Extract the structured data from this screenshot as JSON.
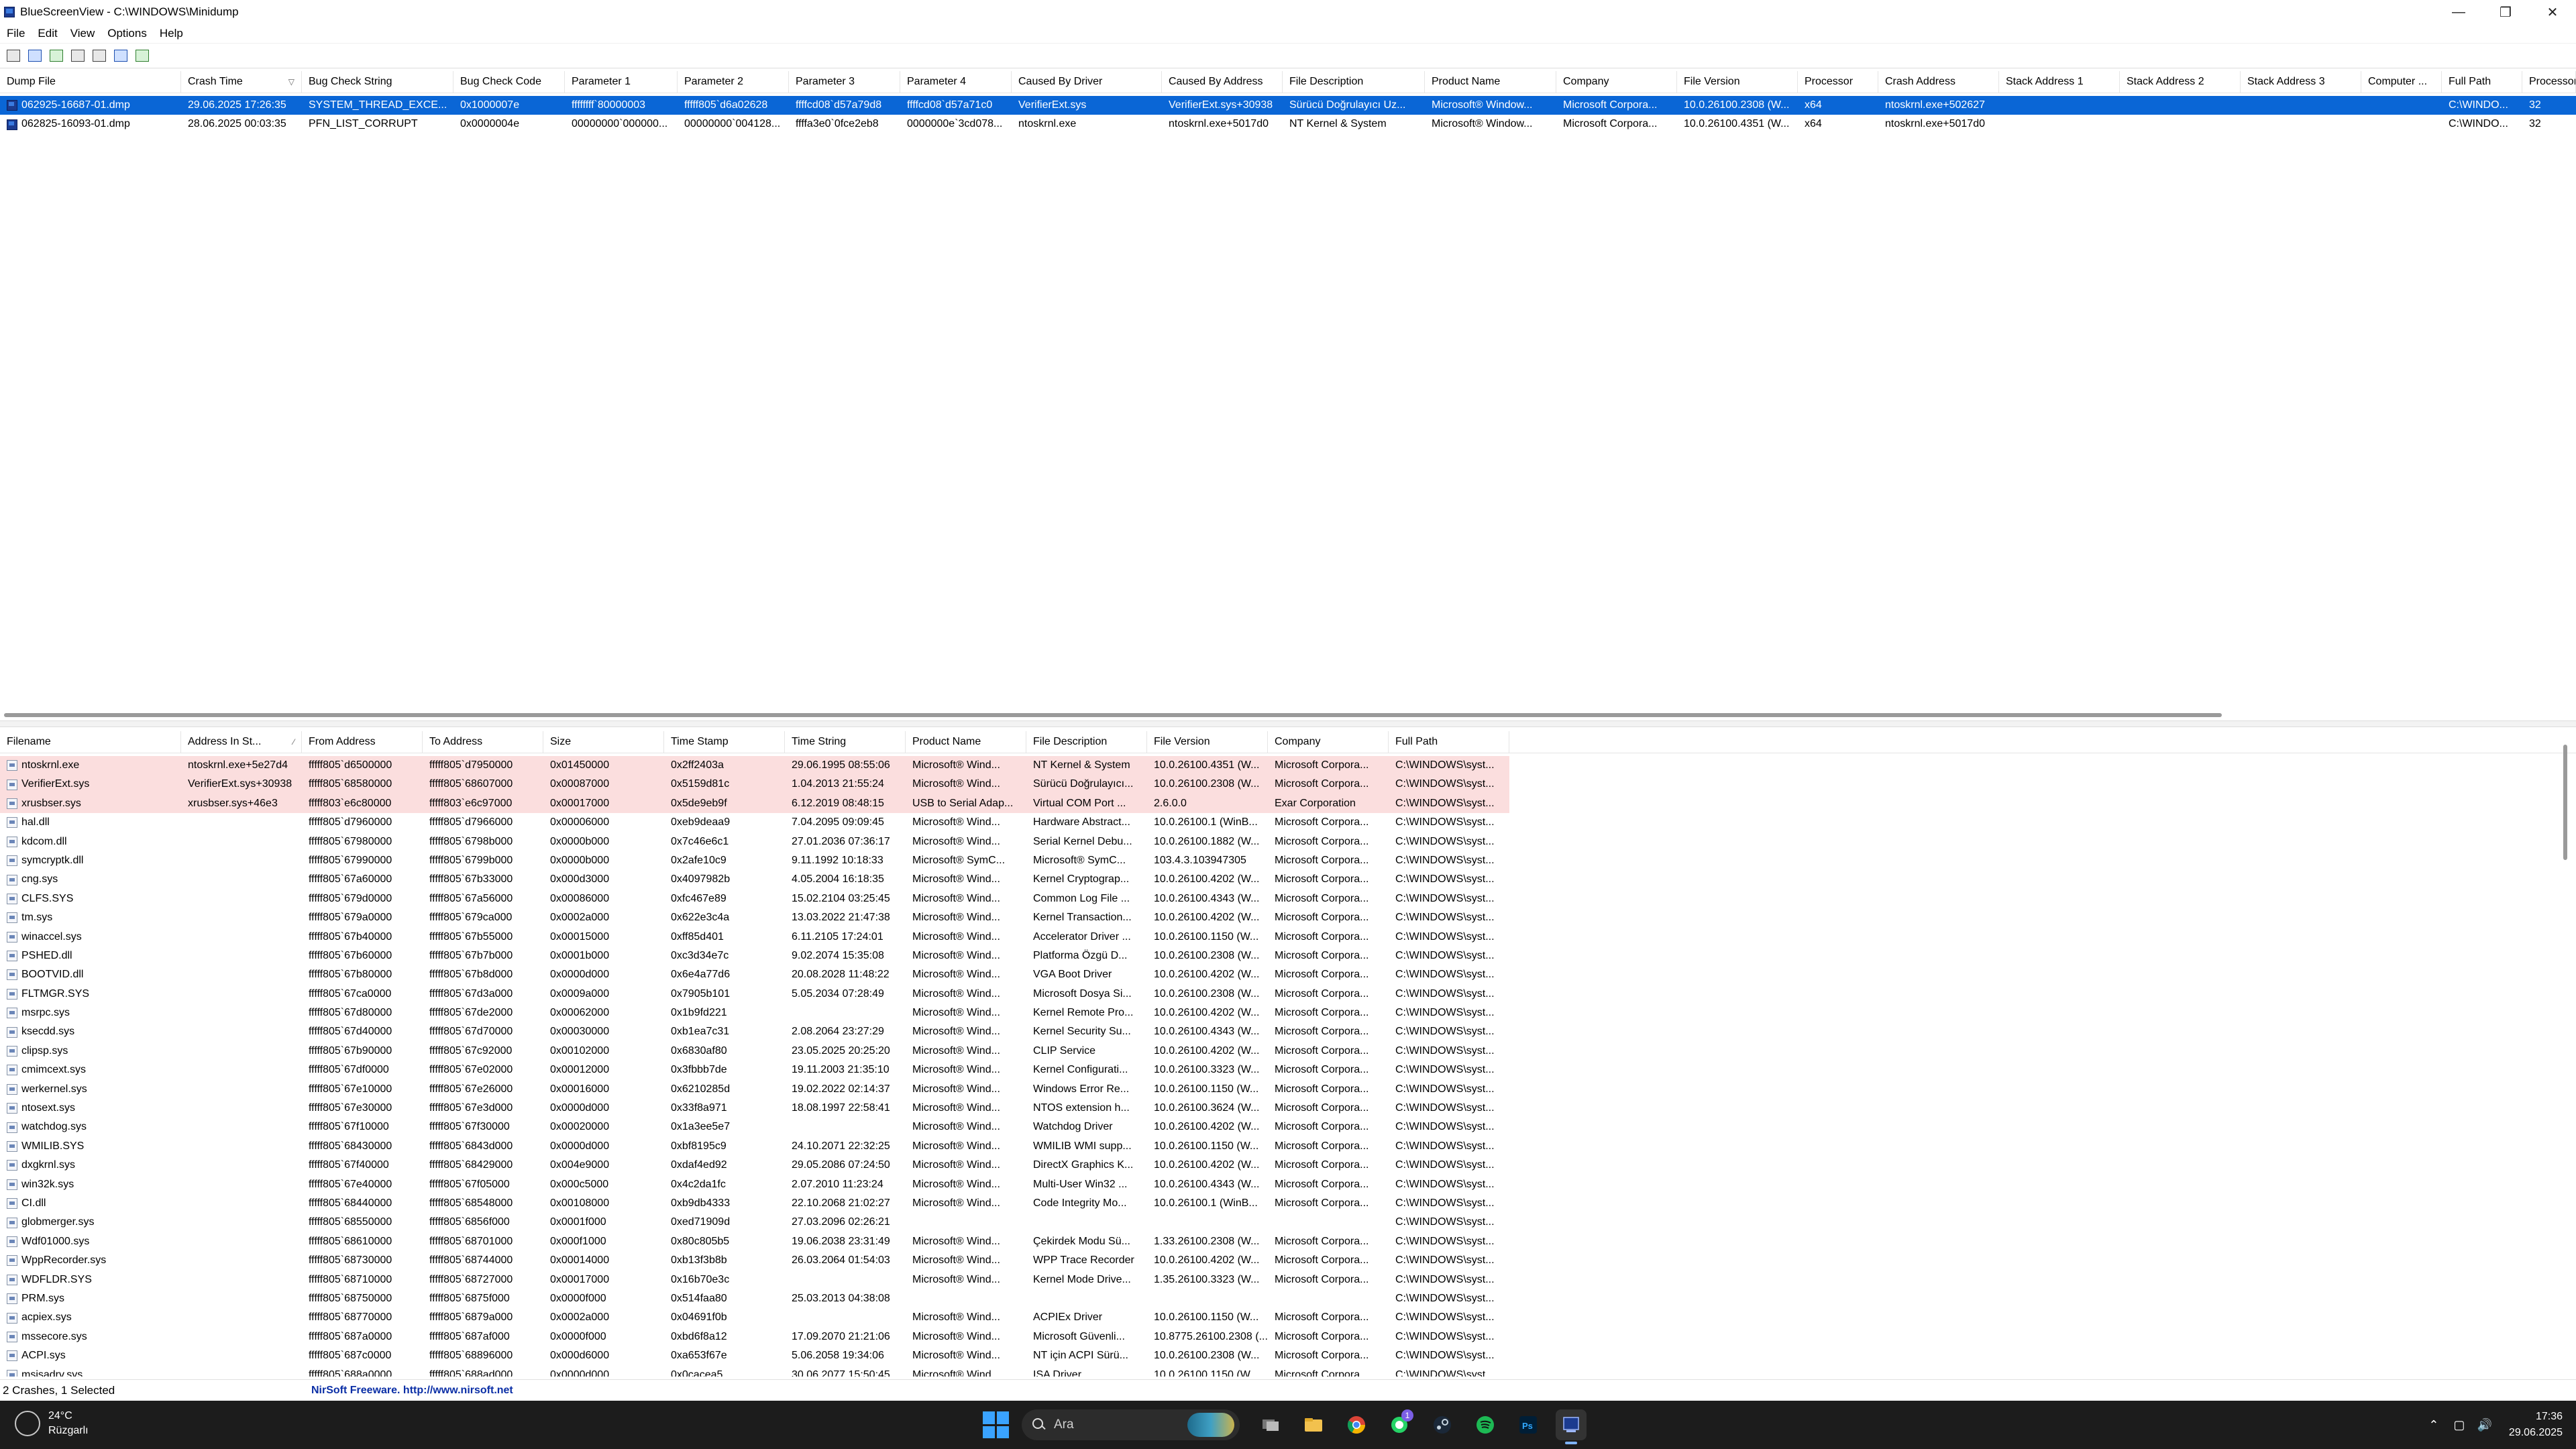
{
  "window": {
    "title": "BlueScreenView - C:\\WINDOWS\\Minidump"
  },
  "menu": [
    "File",
    "Edit",
    "View",
    "Options",
    "Help"
  ],
  "toolbar_icons": [
    "properties-icon",
    "save-icon",
    "html-report-icon",
    "copy-icon",
    "open-folder-icon",
    "find-icon",
    "exit-icon"
  ],
  "crashes": {
    "columns": [
      "Dump File",
      "Crash Time",
      "Bug Check String",
      "Bug Check Code",
      "Parameter 1",
      "Parameter 2",
      "Parameter 3",
      "Parameter 4",
      "Caused By Driver",
      "Caused By Address",
      "File Description",
      "Product Name",
      "Company",
      "File Version",
      "Processor",
      "Crash Address",
      "Stack Address 1",
      "Stack Address 2",
      "Stack Address 3",
      "Computer ...",
      "Full Path",
      "Processors"
    ],
    "sorted_column_marker": "▽",
    "rows": [
      [
        "062925-16687-01.dmp",
        "29.06.2025 17:26:35",
        "SYSTEM_THREAD_EXCE...",
        "0x1000007e",
        "ffffffff`80000003",
        "fffff805`d6a02628",
        "ffffcd08`d57a79d8",
        "ffffcd08`d57a71c0",
        "VerifierExt.sys",
        "VerifierExt.sys+30938",
        "Sürücü Doğrulayıcı Uz...",
        "Microsoft® Window...",
        "Microsoft Corpora...",
        "10.0.26100.2308 (W...",
        "x64",
        "ntoskrnl.exe+502627",
        "",
        "",
        "",
        "",
        "C:\\WINDO...",
        "32"
      ],
      [
        "062825-16093-01.dmp",
        "28.06.2025 00:03:35",
        "PFN_LIST_CORRUPT",
        "0x0000004e",
        "00000000`000000...",
        "00000000`004128...",
        "ffffa3e0`0fce2eb8",
        "0000000e`3cd078...",
        "ntoskrnl.exe",
        "ntoskrnl.exe+5017d0",
        "NT Kernel & System",
        "Microsoft® Window...",
        "Microsoft Corpora...",
        "10.0.26100.4351 (W...",
        "x64",
        "ntoskrnl.exe+5017d0",
        "",
        "",
        "",
        "",
        "C:\\WINDO...",
        "32"
      ]
    ]
  },
  "drivers": {
    "columns": [
      "Filename",
      "Address In St...",
      "From Address",
      "To Address",
      "Size",
      "Time Stamp",
      "Time String",
      "Product Name",
      "File Description",
      "File Version",
      "Company",
      "Full Path"
    ],
    "sorted_column_marker": "⁄",
    "rows": [
      [
        "ntoskrnl.exe",
        "ntoskrnl.exe+5e27d4",
        "fffff805`d6500000",
        "fffff805`d7950000",
        "0x01450000",
        "0x2ff2403a",
        "29.06.1995 08:55:06",
        "Microsoft® Wind...",
        "NT Kernel & System",
        "10.0.26100.4351 (W...",
        "Microsoft Corpora...",
        "C:\\WINDOWS\\syst..."
      ],
      [
        "VerifierExt.sys",
        "VerifierExt.sys+30938",
        "fffff805`68580000",
        "fffff805`68607000",
        "0x00087000",
        "0x5159d81c",
        "1.04.2013 21:55:24",
        "Microsoft® Wind...",
        "Sürücü Doğrulayıcı...",
        "10.0.26100.2308 (W...",
        "Microsoft Corpora...",
        "C:\\WINDOWS\\syst..."
      ],
      [
        "xrusbser.sys",
        "xrusbser.sys+46e3",
        "fffff803`e6c80000",
        "fffff803`e6c97000",
        "0x00017000",
        "0x5de9eb9f",
        "6.12.2019 08:48:15",
        "USB to Serial Adap...",
        "Virtual COM Port ...",
        "2.6.0.0",
        "Exar Corporation",
        "C:\\WINDOWS\\syst..."
      ],
      [
        "hal.dll",
        "",
        "fffff805`d7960000",
        "fffff805`d7966000",
        "0x00006000",
        "0xeb9deaa9",
        "7.04.2095 09:09:45",
        "Microsoft® Wind...",
        "Hardware Abstract...",
        "10.0.26100.1 (WinB...",
        "Microsoft Corpora...",
        "C:\\WINDOWS\\syst..."
      ],
      [
        "kdcom.dll",
        "",
        "fffff805`67980000",
        "fffff805`6798b000",
        "0x0000b000",
        "0x7c46e6c1",
        "27.01.2036 07:36:17",
        "Microsoft® Wind...",
        "Serial Kernel Debu...",
        "10.0.26100.1882 (W...",
        "Microsoft Corpora...",
        "C:\\WINDOWS\\syst..."
      ],
      [
        "symcryptk.dll",
        "",
        "fffff805`67990000",
        "fffff805`6799b000",
        "0x0000b000",
        "0x2afe10c9",
        "9.11.1992 10:18:33",
        "Microsoft® SymC...",
        "Microsoft® SymC...",
        "103.4.3.103947305",
        "Microsoft Corpora...",
        "C:\\WINDOWS\\syst..."
      ],
      [
        "cng.sys",
        "",
        "fffff805`67a60000",
        "fffff805`67b33000",
        "0x000d3000",
        "0x4097982b",
        "4.05.2004 16:18:35",
        "Microsoft® Wind...",
        "Kernel Cryptograp...",
        "10.0.26100.4202 (W...",
        "Microsoft Corpora...",
        "C:\\WINDOWS\\syst..."
      ],
      [
        "CLFS.SYS",
        "",
        "fffff805`679d0000",
        "fffff805`67a56000",
        "0x00086000",
        "0xfc467e89",
        "15.02.2104 03:25:45",
        "Microsoft® Wind...",
        "Common Log File ...",
        "10.0.26100.4343 (W...",
        "Microsoft Corpora...",
        "C:\\WINDOWS\\syst..."
      ],
      [
        "tm.sys",
        "",
        "fffff805`679a0000",
        "fffff805`679ca000",
        "0x0002a000",
        "0x622e3c4a",
        "13.03.2022 21:47:38",
        "Microsoft® Wind...",
        "Kernel Transaction...",
        "10.0.26100.4202 (W...",
        "Microsoft Corpora...",
        "C:\\WINDOWS\\syst..."
      ],
      [
        "winaccel.sys",
        "",
        "fffff805`67b40000",
        "fffff805`67b55000",
        "0x00015000",
        "0xff85d401",
        "6.11.2105 17:24:01",
        "Microsoft® Wind...",
        "Accelerator Driver ...",
        "10.0.26100.1150 (W...",
        "Microsoft Corpora...",
        "C:\\WINDOWS\\syst..."
      ],
      [
        "PSHED.dll",
        "",
        "fffff805`67b60000",
        "fffff805`67b7b000",
        "0x0001b000",
        "0xc3d34e7c",
        "9.02.2074 15:35:08",
        "Microsoft® Wind...",
        "Platforma Özgü D...",
        "10.0.26100.2308 (W...",
        "Microsoft Corpora...",
        "C:\\WINDOWS\\syst..."
      ],
      [
        "BOOTVID.dll",
        "",
        "fffff805`67b80000",
        "fffff805`67b8d000",
        "0x0000d000",
        "0x6e4a77d6",
        "20.08.2028 11:48:22",
        "Microsoft® Wind...",
        "VGA Boot Driver",
        "10.0.26100.4202 (W...",
        "Microsoft Corpora...",
        "C:\\WINDOWS\\syst..."
      ],
      [
        "FLTMGR.SYS",
        "",
        "fffff805`67ca0000",
        "fffff805`67d3a000",
        "0x0009a000",
        "0x7905b101",
        "5.05.2034 07:28:49",
        "Microsoft® Wind...",
        "Microsoft Dosya Si...",
        "10.0.26100.2308 (W...",
        "Microsoft Corpora...",
        "C:\\WINDOWS\\syst..."
      ],
      [
        "msrpc.sys",
        "",
        "fffff805`67d80000",
        "fffff805`67de2000",
        "0x00062000",
        "0x1b9fd221",
        "",
        "Microsoft® Wind...",
        "Kernel Remote Pro...",
        "10.0.26100.4202 (W...",
        "Microsoft Corpora...",
        "C:\\WINDOWS\\syst..."
      ],
      [
        "ksecdd.sys",
        "",
        "fffff805`67d40000",
        "fffff805`67d70000",
        "0x00030000",
        "0xb1ea7c31",
        "2.08.2064 23:27:29",
        "Microsoft® Wind...",
        "Kernel Security Su...",
        "10.0.26100.4343 (W...",
        "Microsoft Corpora...",
        "C:\\WINDOWS\\syst..."
      ],
      [
        "clipsp.sys",
        "",
        "fffff805`67b90000",
        "fffff805`67c92000",
        "0x00102000",
        "0x6830af80",
        "23.05.2025 20:25:20",
        "Microsoft® Wind...",
        "CLIP Service",
        "10.0.26100.4202 (W...",
        "Microsoft Corpora...",
        "C:\\WINDOWS\\syst..."
      ],
      [
        "cmimcext.sys",
        "",
        "fffff805`67df0000",
        "fffff805`67e02000",
        "0x00012000",
        "0x3fbbb7de",
        "19.11.2003 21:35:10",
        "Microsoft® Wind...",
        "Kernel Configurati...",
        "10.0.26100.3323 (W...",
        "Microsoft Corpora...",
        "C:\\WINDOWS\\syst..."
      ],
      [
        "werkernel.sys",
        "",
        "fffff805`67e10000",
        "fffff805`67e26000",
        "0x00016000",
        "0x6210285d",
        "19.02.2022 02:14:37",
        "Microsoft® Wind...",
        "Windows Error Re...",
        "10.0.26100.1150 (W...",
        "Microsoft Corpora...",
        "C:\\WINDOWS\\syst..."
      ],
      [
        "ntosext.sys",
        "",
        "fffff805`67e30000",
        "fffff805`67e3d000",
        "0x0000d000",
        "0x33f8a971",
        "18.08.1997 22:58:41",
        "Microsoft® Wind...",
        "NTOS extension h...",
        "10.0.26100.3624 (W...",
        "Microsoft Corpora...",
        "C:\\WINDOWS\\syst..."
      ],
      [
        "watchdog.sys",
        "",
        "fffff805`67f10000",
        "fffff805`67f30000",
        "0x00020000",
        "0x1a3ee5e7",
        "",
        "Microsoft® Wind...",
        "Watchdog Driver",
        "10.0.26100.4202 (W...",
        "Microsoft Corpora...",
        "C:\\WINDOWS\\syst..."
      ],
      [
        "WMILIB.SYS",
        "",
        "fffff805`68430000",
        "fffff805`6843d000",
        "0x0000d000",
        "0xbf8195c9",
        "24.10.2071 22:32:25",
        "Microsoft® Wind...",
        "WMILIB WMI supp...",
        "10.0.26100.1150 (W...",
        "Microsoft Corpora...",
        "C:\\WINDOWS\\syst..."
      ],
      [
        "dxgkrnl.sys",
        "",
        "fffff805`67f40000",
        "fffff805`68429000",
        "0x004e9000",
        "0xdaf4ed92",
        "29.05.2086 07:24:50",
        "Microsoft® Wind...",
        "DirectX Graphics K...",
        "10.0.26100.4202 (W...",
        "Microsoft Corpora...",
        "C:\\WINDOWS\\syst..."
      ],
      [
        "win32k.sys",
        "",
        "fffff805`67e40000",
        "fffff805`67f05000",
        "0x000c5000",
        "0x4c2da1fc",
        "2.07.2010 11:23:24",
        "Microsoft® Wind...",
        "Multi-User Win32 ...",
        "10.0.26100.4343 (W...",
        "Microsoft Corpora...",
        "C:\\WINDOWS\\syst..."
      ],
      [
        "CI.dll",
        "",
        "fffff805`68440000",
        "fffff805`68548000",
        "0x00108000",
        "0xb9db4333",
        "22.10.2068 21:02:27",
        "Microsoft® Wind...",
        "Code Integrity Mo...",
        "10.0.26100.1 (WinB...",
        "Microsoft Corpora...",
        "C:\\WINDOWS\\syst..."
      ],
      [
        "globmerger.sys",
        "",
        "fffff805`68550000",
        "fffff805`6856f000",
        "0x0001f000",
        "0xed71909d",
        "27.03.2096 02:26:21",
        "",
        "",
        "",
        "",
        "C:\\WINDOWS\\syst..."
      ],
      [
        "Wdf01000.sys",
        "",
        "fffff805`68610000",
        "fffff805`68701000",
        "0x000f1000",
        "0x80c805b5",
        "19.06.2038 23:31:49",
        "Microsoft® Wind...",
        "Çekirdek Modu Sü...",
        "1.33.26100.2308 (W...",
        "Microsoft Corpora...",
        "C:\\WINDOWS\\syst..."
      ],
      [
        "WppRecorder.sys",
        "",
        "fffff805`68730000",
        "fffff805`68744000",
        "0x00014000",
        "0xb13f3b8b",
        "26.03.2064 01:54:03",
        "Microsoft® Wind...",
        "WPP Trace Recorder",
        "10.0.26100.4202 (W...",
        "Microsoft Corpora...",
        "C:\\WINDOWS\\syst..."
      ],
      [
        "WDFLDR.SYS",
        "",
        "fffff805`68710000",
        "fffff805`68727000",
        "0x00017000",
        "0x16b70e3c",
        "",
        "Microsoft® Wind...",
        "Kernel Mode Drive...",
        "1.35.26100.3323 (W...",
        "Microsoft Corpora...",
        "C:\\WINDOWS\\syst..."
      ],
      [
        "PRM.sys",
        "",
        "fffff805`68750000",
        "fffff805`6875f000",
        "0x0000f000",
        "0x514faa80",
        "25.03.2013 04:38:08",
        "",
        "",
        "",
        "",
        "C:\\WINDOWS\\syst..."
      ],
      [
        "acpiex.sys",
        "",
        "fffff805`68770000",
        "fffff805`6879a000",
        "0x0002a000",
        "0x04691f0b",
        "",
        "Microsoft® Wind...",
        "ACPIEx Driver",
        "10.0.26100.1150 (W...",
        "Microsoft Corpora...",
        "C:\\WINDOWS\\syst..."
      ],
      [
        "mssecore.sys",
        "",
        "fffff805`687a0000",
        "fffff805`687af000",
        "0x0000f000",
        "0xbd6f8a12",
        "17.09.2070 21:21:06",
        "Microsoft® Wind...",
        "Microsoft Güvenli...",
        "10.8775.26100.2308 (...",
        "Microsoft Corpora...",
        "C:\\WINDOWS\\syst..."
      ],
      [
        "ACPI.sys",
        "",
        "fffff805`687c0000",
        "fffff805`68896000",
        "0x000d6000",
        "0xa653f67e",
        "5.06.2058 19:34:06",
        "Microsoft® Wind...",
        "NT için ACPI Sürü...",
        "10.0.26100.2308 (W...",
        "Microsoft Corpora...",
        "C:\\WINDOWS\\syst..."
      ],
      [
        "msisadrv.sys",
        "",
        "fffff805`688a0000",
        "fffff805`688ad000",
        "0x0000d000",
        "0x0cacea5",
        "30.06.2077 15:50:45",
        "Microsoft® Wind...",
        "ISA Driver",
        "10.0.26100.1150 (W...",
        "Microsoft Corpora...",
        "C:\\WINDOWS\\syst..."
      ]
    ]
  },
  "status": {
    "summary": "2 Crashes, 1 Selected",
    "freeware": "NirSoft Freeware.  http://www.nirsoft.net"
  },
  "taskbar": {
    "weather_temp": "24°C",
    "weather_desc": "Rüzgarlı",
    "search_placeholder": "Ara",
    "whatsapp_badge": "1",
    "time": "17:36",
    "date": "29.06.2025"
  }
}
